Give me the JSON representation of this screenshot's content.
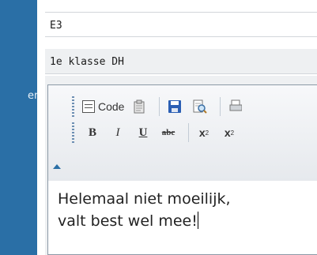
{
  "left_panel": {
    "label": "en",
    "color": "#2a6fa6"
  },
  "fields": {
    "row1_value": "E3",
    "row2_value": "1e klasse DH"
  },
  "toolbar": {
    "code_label": "Code",
    "bold_label": "B",
    "italic_label": "I",
    "underline_label": "U",
    "strike_label": "abc",
    "subscript_label": "x",
    "subscript_mark": "2",
    "superscript_label": "x",
    "superscript_mark": "2"
  },
  "editor": {
    "line1": "Helemaal niet moeilijk,",
    "line2": "valt best wel mee!"
  }
}
